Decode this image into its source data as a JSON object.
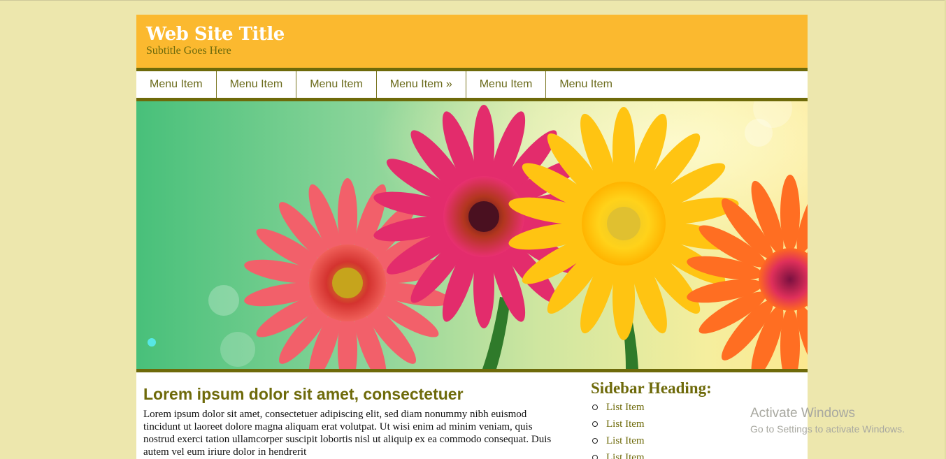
{
  "site": {
    "title": "Web Site Title",
    "subtitle": "Subtitle Goes Here"
  },
  "nav": {
    "items": [
      {
        "label": "Menu Item"
      },
      {
        "label": "Menu Item"
      },
      {
        "label": "Menu Item"
      },
      {
        "label": "Menu Item »"
      },
      {
        "label": "Menu Item"
      },
      {
        "label": "Menu Item"
      }
    ]
  },
  "hero": {
    "image": "gerbera-daisies-banner"
  },
  "main": {
    "heading": "Lorem ipsum dolor sit amet, consectetuer",
    "paragraph": "Lorem ipsum dolor sit amet, consectetuer adipiscing elit, sed diam nonummy nibh euismod tincidunt ut laoreet dolore magna aliquam erat volutpat. Ut wisi enim ad minim veniam, quis nostrud exerci tation ullamcorper suscipit lobortis nisl ut aliquip ex ea commodo consequat. Duis autem vel eum iriure dolor in hendrerit"
  },
  "sidebar": {
    "heading": "Sidebar Heading:",
    "items": [
      {
        "label": "List Item"
      },
      {
        "label": "List Item"
      },
      {
        "label": "List Item"
      },
      {
        "label": "List Item"
      }
    ]
  },
  "watermark": {
    "title": "Activate Windows",
    "subtitle": "Go to Settings to activate Windows."
  },
  "colors": {
    "page_bg": "#ede7ad",
    "header_bg": "#fbb92f",
    "accent_olive": "#6e6a0a"
  }
}
